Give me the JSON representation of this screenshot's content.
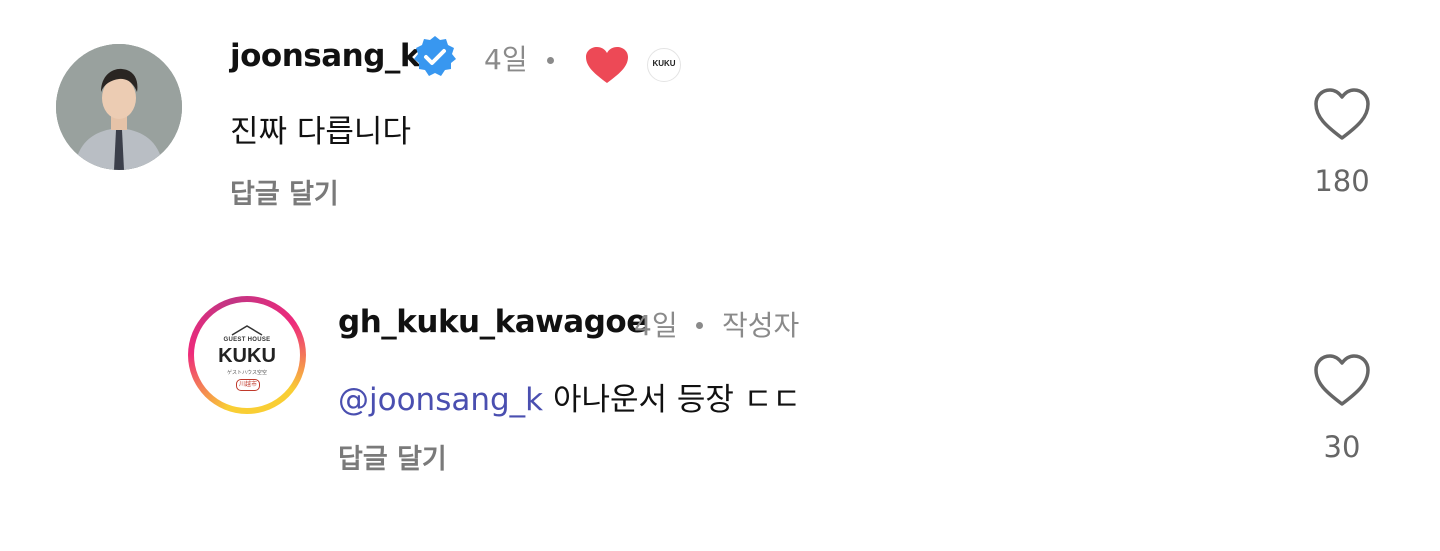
{
  "comments": [
    {
      "username": "joonsang_k",
      "verified": true,
      "time": "4일",
      "creator_liked_logo_text": "KUKU",
      "text": "진짜 다릅니다",
      "reply_label": "답글 달기",
      "like_count": "180"
    },
    {
      "username": "gh_kuku_kawagoe",
      "time": "4일",
      "author_tag": "작성자",
      "mention": "@joonsang_k",
      "text": " 아나운서 등장 ㄷㄷ",
      "reply_label": "답글 달기",
      "like_count": "30",
      "avatar_logo": {
        "top": "GUEST HOUSE",
        "name": "KUKU",
        "sub": "ゲストハウス空空",
        "badge": "川越市"
      }
    }
  ],
  "colors": {
    "verified_badge": "#3897f0",
    "heart": "#ed4956",
    "mention": "#4a4fb0",
    "story_ring": [
      "#f9ce34",
      "#ee2a7b",
      "#6228d7"
    ]
  }
}
